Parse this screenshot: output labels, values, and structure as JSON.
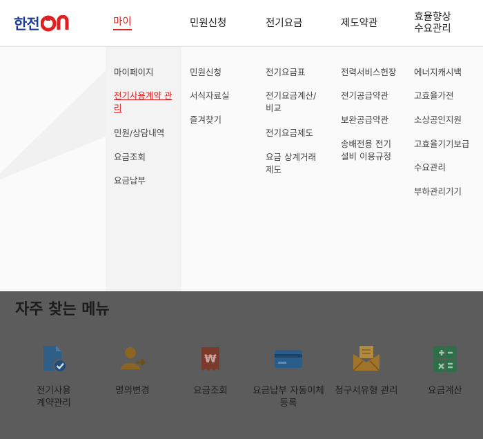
{
  "logo": {
    "text": "한전",
    "suffix": "ON"
  },
  "gnb": [
    {
      "label": "마이"
    },
    {
      "label": "민원신청"
    },
    {
      "label": "전기요금"
    },
    {
      "label": "제도약관"
    },
    {
      "label": "효율향상 수요관리"
    }
  ],
  "menu": {
    "col1": [
      "마이페이지",
      "전기사용계약 관리",
      "민원/상담내역",
      "요금조회",
      "요금납부"
    ],
    "col2": [
      "민원신청",
      "서식자료실",
      "즐겨찾기"
    ],
    "col3": [
      "전기요금표",
      "전기요금계산/ 비교",
      "전기요금제도",
      "요금 상계거래 제도"
    ],
    "col4": [
      "전력서비스헌장",
      "전기공급약관",
      "보완공급약관",
      "송배전용 전기 설비 이용규정"
    ],
    "col5": [
      "에너지캐시백",
      "고효율가전",
      "소상공인지원",
      "고효율기기보급",
      "수요관리",
      "부하관리기기"
    ]
  },
  "favorites": {
    "title": "자주 찾는 메뉴",
    "items": [
      {
        "label": "전기사용 계약관리",
        "icon": "document-check-icon"
      },
      {
        "label": "명의변경",
        "icon": "person-transfer-icon"
      },
      {
        "label": "요금조회",
        "icon": "receipt-won-icon"
      },
      {
        "label": "요금납부 자동이체등록",
        "icon": "credit-card-icon"
      },
      {
        "label": "청구서유형 관리",
        "icon": "envelope-icon"
      },
      {
        "label": "요금계산",
        "icon": "calculator-icon"
      }
    ]
  },
  "colors": {
    "accent": "#e02020",
    "brand": "#1f3f95",
    "overlay": "#5c5c5c"
  }
}
